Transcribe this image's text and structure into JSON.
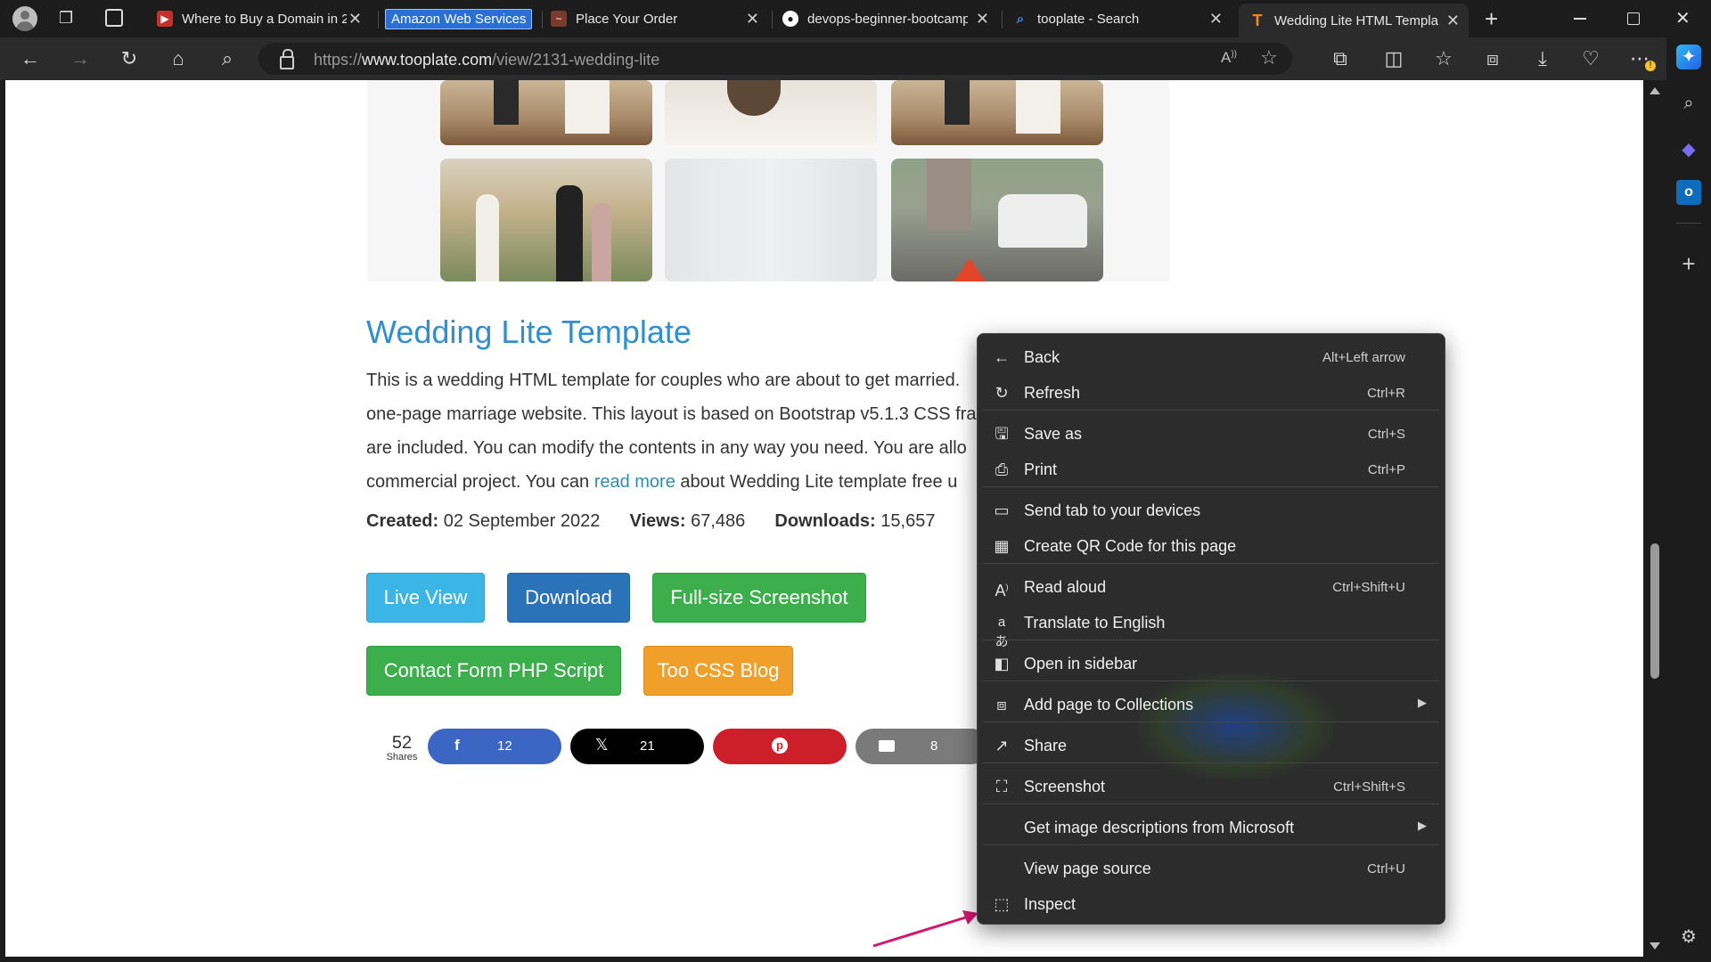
{
  "tabs": [
    {
      "title": "Where to Buy a Domain in 2",
      "favicon": "youtube-icon",
      "active": false
    },
    {
      "title": "Amazon Web Services",
      "favicon": "",
      "active": false
    },
    {
      "title": "Place Your Order",
      "favicon": "order-icon",
      "active": false
    },
    {
      "title": "devops-beginner-bootcamp",
      "favicon": "github-icon",
      "active": false
    },
    {
      "title": "tooplate - Search",
      "favicon": "search-icon",
      "active": false
    },
    {
      "title": "Wedding Lite HTML Templa",
      "favicon": "tooplate-icon",
      "active": true
    }
  ],
  "address_bar": {
    "url_prefix": "https://",
    "url_domain": "www.tooplate.com",
    "url_path": "/view/2131-wedding-lite"
  },
  "page": {
    "title": "Wedding Lite Template",
    "description_lines": [
      "This is a wedding HTML template for couples who are about to get married.",
      "one-page marriage website. This layout is based on Bootstrap v5.1.3 CSS fra",
      "are included. You can modify the contents in any way you need. You are allo"
    ],
    "description_line4_before": "commercial project. You can ",
    "read_more": "read more",
    "description_line4_after": " about Wedding Lite template free u",
    "created_label": "Created:",
    "created_value": "02 September 2022",
    "views_label": "Views:",
    "views_value": "67,486",
    "downloads_label": "Downloads:",
    "downloads_value": "15,657",
    "buttons": {
      "live_view": "Live View",
      "download": "Download",
      "screenshot": "Full-size Screenshot",
      "contact_form": "Contact Form PHP Script",
      "css_blog": "Too CSS Blog"
    },
    "shares": {
      "total": "52",
      "total_label": "Shares",
      "facebook": "12",
      "x": "21",
      "email": "8"
    }
  },
  "context_menu": {
    "items": [
      {
        "label": "Back",
        "shortcut": "Alt+Left arrow",
        "icon": "back-arrow-icon"
      },
      {
        "label": "Refresh",
        "shortcut": "Ctrl+R",
        "icon": "refresh-icon"
      },
      {
        "label": "Save as",
        "shortcut": "Ctrl+S",
        "icon": "save-icon"
      },
      {
        "label": "Print",
        "shortcut": "Ctrl+P",
        "icon": "printer-icon"
      },
      {
        "label": "Send tab to your devices",
        "shortcut": "",
        "icon": "devices-icon"
      },
      {
        "label": "Create QR Code for this page",
        "shortcut": "",
        "icon": "qr-code-icon"
      },
      {
        "label": "Read aloud",
        "shortcut": "Ctrl+Shift+U",
        "icon": "read-aloud-icon"
      },
      {
        "label": "Translate to English",
        "shortcut": "",
        "icon": "translate-icon"
      },
      {
        "label": "Open in sidebar",
        "shortcut": "",
        "icon": "sidebar-icon"
      },
      {
        "label": "Add page to Collections",
        "shortcut": "",
        "icon": "collections-icon"
      },
      {
        "label": "Share",
        "shortcut": "",
        "icon": "share-icon"
      },
      {
        "label": "Screenshot",
        "shortcut": "Ctrl+Shift+S",
        "icon": "screenshot-icon"
      },
      {
        "label": "Get image descriptions from Microsoft",
        "shortcut": "",
        "icon": ""
      },
      {
        "label": "View page source",
        "shortcut": "Ctrl+U",
        "icon": ""
      },
      {
        "label": "Inspect",
        "shortcut": "",
        "icon": "inspect-icon"
      }
    ]
  },
  "colors": {
    "accent_blue": "#2f8fd0",
    "live_view": "#3bb5e5",
    "download": "#2a73b8",
    "green": "#3caf4c",
    "orange": "#f0a02a",
    "facebook": "#3b66c4",
    "x_black": "#000000",
    "pinterest": "#cc1f2a",
    "email_gray": "#7a7a7a",
    "arrow_pink": "#d0186e"
  }
}
